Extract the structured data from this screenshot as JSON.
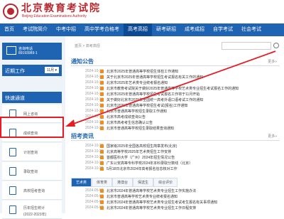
{
  "header": {
    "title_cn": "北京教育考试院",
    "title_en": "Beijing Education Examinations Authority"
  },
  "nav": [
    "首页",
    "考试院简介",
    "中考中招",
    "高中学考合格考",
    "高考高招",
    "研考研招",
    "成考成招",
    "自学考试",
    "社会考试"
  ],
  "nav_active": 4,
  "sidebar": {
    "login_line1": "咨询电话",
    "login_line2": "89193989-1",
    "recent_title": "近期工作",
    "recent_month": "11月 ▾",
    "quick_title": "快速通道",
    "quick": [
      {
        "label": "网上咨询"
      },
      {
        "label": "成绩查询"
      },
      {
        "label": "计划查询"
      },
      {
        "label": "录取查询"
      },
      {
        "label": "高校招考查询"
      },
      {
        "label": "历年招生统计",
        "label2": "(2022-2023年)"
      }
    ]
  },
  "main": {
    "breadcrumb": "首页 > 高考高招",
    "notice_title": "通知公告",
    "notice_more": "更多»",
    "notices": [
      {
        "date": "2024-10-31",
        "text": "北京市2025年普通高等学校招生体检工作通知"
      },
      {
        "date": "2024-10-31",
        "text": "关于北京市2025年普通高等学校招生考试报名有关工作的通知"
      },
      {
        "date": "2024-10-31",
        "text": "北京市2025年艺术类专业统考报名通知"
      },
      {
        "date": "2024-10-31",
        "text": "北京市教育考试院关于做好2025年普通高等学校艺术类专业招生考试报名工作的通知"
      },
      {
        "date": "2024-10-31",
        "text": "北京市2025年普通高等学校招生考试报名工作将于11月开始"
      },
      {
        "date": "2024-10-31",
        "text": "关于做好北京市2025年全国统一高考外语口语考试工作的通知"
      },
      {
        "date": "2024-10-31",
        "text": "北京市2025年普通高等学校招生考试(报名)工作通知"
      },
      {
        "date": "2024-10-23",
        "text": "北京市普通高等学校招生录取工作通知"
      },
      {
        "date": "2024-10-23",
        "text": "北京市高考成绩查询公告"
      },
      {
        "date": "2024-10-23",
        "text": "北京市高考考生信息确认公告"
      },
      {
        "date": "2024-10-23",
        "text": "北京市普通高等学校招生录取结果查询通知"
      }
    ],
    "recruit_title": "招考资讯",
    "recruit_more": "更多»",
    "recruits": [
      {
        "date": "2024-10-26",
        "text": "国家级2025年全国各高校招生简章发布(北京)"
      },
      {
        "date": "2024-10-26",
        "text": "北京高等学校2025年艺术类招生工作安排"
      },
      {
        "date": "2024-10-26",
        "text": "首都医科大学（广州）2024年招生情况公告"
      },
      {
        "date": "2024-10-26",
        "text": "广东公安高等专科学校2024年本科录取分数线（北京）"
      },
      {
        "date": "2024-10-26",
        "text": "5月18日北京市2024年高考报名信息核对工作"
      }
    ],
    "tabs": [
      "艺术类",
      "体育类",
      "港澳台",
      "保送生",
      "综合评价"
    ],
    "tab_rows": [
      {
        "date": "2024-05-08",
        "text": "北京市2024年普通高等学校艺术类专业招生工作实施办法"
      },
      {
        "date": "2024-05-08",
        "text": "北京市普通高等学校艺术类专业统考报名通知"
      },
      {
        "date": "2024-05-08",
        "text": "北京市2024年普通高等学校艺术类专业招生考试考生报名有关事项通知"
      },
      {
        "date": "2024-05-08",
        "text": "北京市2024年普通高等学校艺术类专业招生工作日程安排"
      }
    ]
  }
}
